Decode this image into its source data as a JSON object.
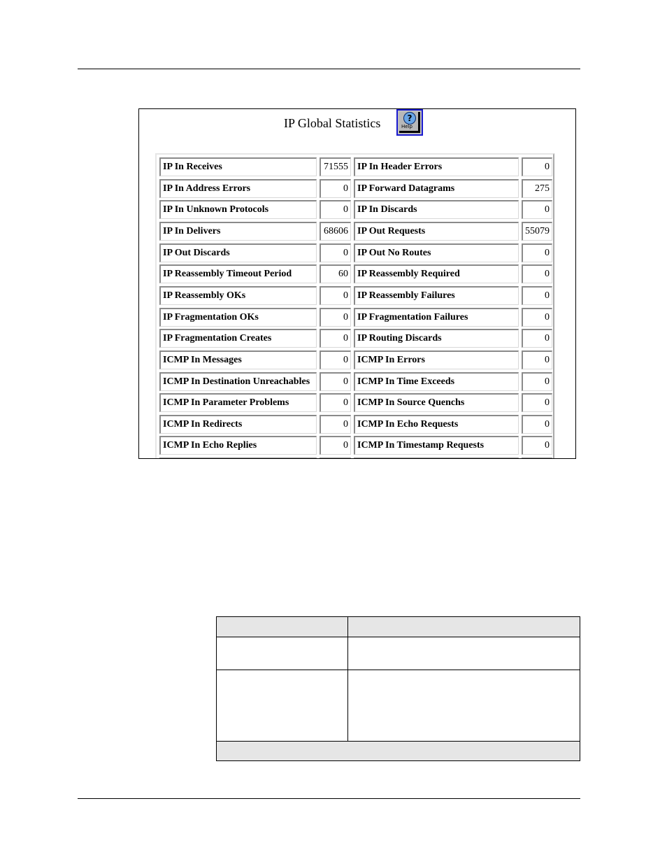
{
  "screenshot": {
    "title": "IP Global Statistics",
    "help_button": {
      "icon": "question-mark-icon",
      "label": "Help"
    },
    "stats": [
      {
        "left_label": "IP In Receives",
        "left_value": "71555",
        "right_label": "IP In Header Errors",
        "right_value": "0"
      },
      {
        "left_label": "IP In Address Errors",
        "left_value": "0",
        "right_label": "IP Forward Datagrams",
        "right_value": "275"
      },
      {
        "left_label": "IP In Unknown Protocols",
        "left_value": "0",
        "right_label": "IP In Discards",
        "right_value": "0"
      },
      {
        "left_label": "IP In Delivers",
        "left_value": "68606",
        "right_label": "IP Out Requests",
        "right_value": "55079"
      },
      {
        "left_label": "IP Out Discards",
        "left_value": "0",
        "right_label": "IP Out No Routes",
        "right_value": "0"
      },
      {
        "left_label": "IP Reassembly Timeout Period",
        "left_value": "60",
        "right_label": "IP Reassembly Required",
        "right_value": "0"
      },
      {
        "left_label": "IP Reassembly OKs",
        "left_value": "0",
        "right_label": "IP Reassembly Failures",
        "right_value": "0"
      },
      {
        "left_label": "IP Fragmentation OKs",
        "left_value": "0",
        "right_label": "IP Fragmentation Failures",
        "right_value": "0"
      },
      {
        "left_label": "IP Fragmentation Creates",
        "left_value": "0",
        "right_label": "IP Routing Discards",
        "right_value": "0"
      },
      {
        "left_label": "ICMP In Messages",
        "left_value": "0",
        "right_label": "ICMP In Errors",
        "right_value": "0"
      },
      {
        "left_label": "ICMP In Destination Unreachables",
        "left_value": "0",
        "right_label": "ICMP In Time Exceeds",
        "right_value": "0"
      },
      {
        "left_label": "ICMP In Parameter Problems",
        "left_value": "0",
        "right_label": "ICMP In Source Quenchs",
        "right_value": "0"
      },
      {
        "left_label": "ICMP In Redirects",
        "left_value": "0",
        "right_label": "ICMP In Echo Requests",
        "right_value": "0"
      },
      {
        "left_label": "ICMP In Echo Replies",
        "left_value": "0",
        "right_label": "ICMP In Timestamp Requests",
        "right_value": "0"
      },
      {
        "left_label": "",
        "left_value": "",
        "right_label": "",
        "right_value": ""
      }
    ]
  },
  "doc_table": {
    "headers": [
      "",
      ""
    ],
    "rows": [
      [
        "",
        ""
      ],
      [
        "",
        ""
      ]
    ],
    "footer": ""
  }
}
